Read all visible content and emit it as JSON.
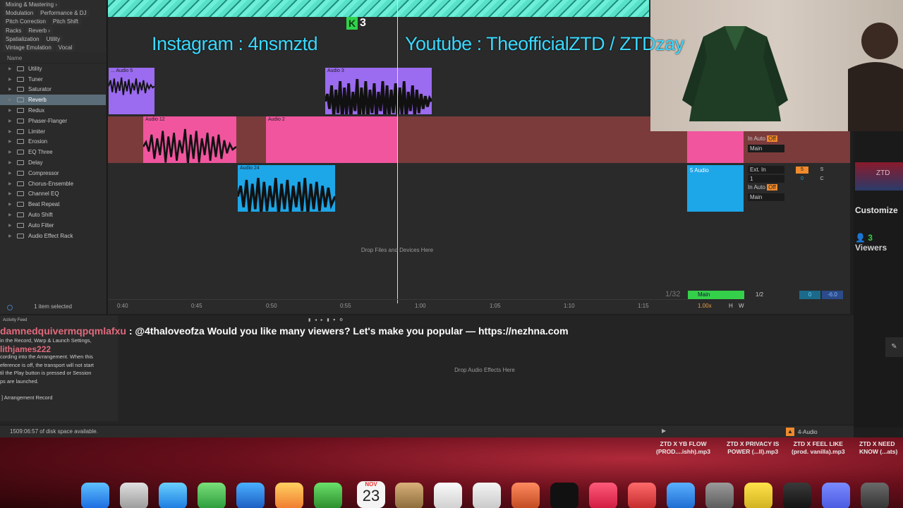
{
  "browser": {
    "tag_rows": [
      [
        "Mixing & Mastering ›"
      ],
      [
        "Modulation",
        "Performance & DJ"
      ],
      [
        "Pitch Correction",
        "Pitch Shift"
      ],
      [
        "Racks",
        "Reverb ›"
      ],
      [
        "Spatialization",
        "Utility"
      ],
      [
        "Vintage Emulation",
        "Vocal"
      ]
    ],
    "column_header": "Name",
    "items": [
      "Utility",
      "Tuner",
      "Saturator",
      "Reverb",
      "Redux",
      "Phaser-Flanger",
      "Limiter",
      "Erosion",
      "EQ Three",
      "Delay",
      "Compressor",
      "Chorus-Ensemble",
      "Channel EQ",
      "Beat Repeat",
      "Auto Shift",
      "Auto Filter",
      "Audio Effect Rack"
    ],
    "selected_item": "Reverb",
    "status": "1 item selected"
  },
  "arrangement": {
    "overlay_badge": "3",
    "overlay_badge_logo": "K",
    "clips": {
      "audio5": "... Audio 5",
      "audio3": "Audio 3",
      "audio12": "Audio 12",
      "audio2": "Audio 2",
      "audio24": "Audio 24"
    },
    "drop_hint": "Drop Files and Devices Here",
    "ruler": [
      "0:40",
      "0:45",
      "0:50",
      "0:55",
      "1:00",
      "1:05",
      "1:10",
      "1:15"
    ],
    "quantize": "1/32",
    "tracks": {
      "t4": {
        "input": "In",
        "auto": "Auto",
        "off": "Off",
        "output": "Main"
      },
      "t5": {
        "name": "5 Audio",
        "input": "Ext. In",
        "ch": "1",
        "in": "In",
        "auto": "Auto",
        "off": "Off",
        "output": "Main",
        "num": "5",
        "s": "S",
        "vol": "0",
        "pan": "C"
      }
    },
    "main": {
      "label": "Main",
      "div": "1/2",
      "vol": "0",
      "db": "-6.0",
      "tempo": "1.00x",
      "h": "H",
      "w": "W"
    }
  },
  "bottom": {
    "activity_title": "Activity Feed",
    "info_lines": [
      "in the Record, Warp & Launch Settings,",
      "",
      "cording into the Arrangement. When this",
      "eference is off, the transport will not start",
      "til the Play button is pressed or Session",
      "ps are launched."
    ],
    "info_sub": "] Arrangement Record",
    "drop_fx": "Drop Audio Effects Here",
    "chat_user": "damnedquivermqpqmlafxu",
    "chat_message": ": @4thaloveofza Would you like many viewers? Let's make you popular — https://nezhna.com",
    "chat_user2": "lithjames222",
    "disk": "1509:06:57 of disk space available.",
    "selected_track": "4-Audio"
  },
  "stream": {
    "customize": "Customize",
    "viewers_count": "3",
    "viewers_label": "Viewers",
    "thumb_text": "ZTD"
  },
  "desktop": {
    "files": [
      [
        "ZTD X YB FLOW",
        "(PROD....ishh).mp3"
      ],
      [
        "ZTD X PRIVACY IS",
        "POWER (...ll).mp3"
      ],
      [
        "ZTD X FEEL LIKE",
        "(prod. vanilla).mp3"
      ],
      [
        "ZTD X NEED",
        "KNOW (...ats)"
      ]
    ],
    "banner_instagram": "Instagram : 4nsmztd",
    "banner_youtube": "Youtube : TheofficialZTD / ZTDzay",
    "calendar_month": "NOV",
    "calendar_day": "23"
  },
  "colors": {
    "purple_clip": "#9b6bf0",
    "pink_clip": "#f0559e",
    "blue_clip": "#1da6e8",
    "accent_off": "#f08a2c",
    "viewers_green": "#35d04a"
  }
}
